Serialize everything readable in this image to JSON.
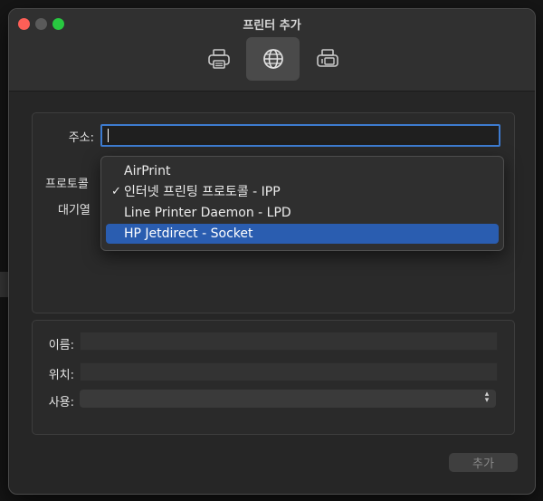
{
  "window": {
    "title": "프린터 추가"
  },
  "toolbar": {
    "items": [
      {
        "icon": "printer-icon",
        "selected": false
      },
      {
        "icon": "globe-icon",
        "selected": true
      },
      {
        "icon": "fax-printer-icon",
        "selected": false
      }
    ]
  },
  "form": {
    "address_label": "주소:",
    "address_value": "",
    "protocol_label": "프로토콜",
    "queue_label": "대기열"
  },
  "protocol_menu": {
    "items": [
      {
        "label": "AirPrint",
        "checked": false,
        "highlighted": false
      },
      {
        "label": "인터넷 프린팅 프로토콜 - IPP",
        "checked": true,
        "highlighted": false
      },
      {
        "label": "Line Printer Daemon - LPD",
        "checked": false,
        "highlighted": false
      },
      {
        "label": "HP Jetdirect - Socket",
        "checked": false,
        "highlighted": true
      }
    ],
    "check_glyph": "✓"
  },
  "details": {
    "name_label": "이름:",
    "name_value": "",
    "location_label": "위치:",
    "location_value": "",
    "use_label": "사용:",
    "use_value": ""
  },
  "buttons": {
    "add_label": "추가",
    "add_enabled": false
  },
  "colors": {
    "close": "#fe5f57",
    "minimize": "#5a5a5a",
    "maximize": "#28c840",
    "focus_ring": "#3d7bd0",
    "menu_highlight": "#2a5db0"
  }
}
